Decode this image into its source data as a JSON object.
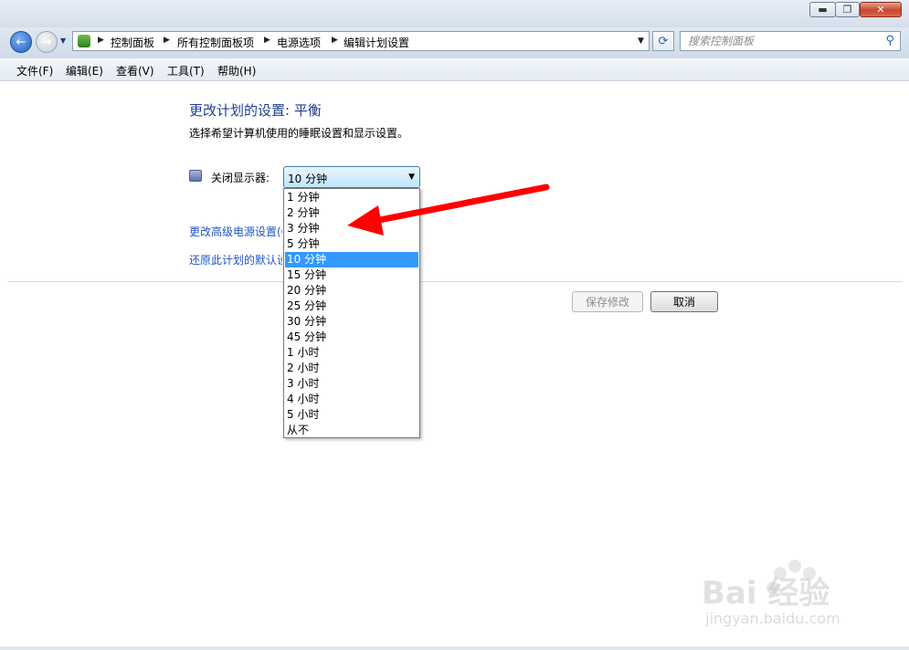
{
  "window": {
    "minimize_label": "▬",
    "maximize_label": "❐",
    "close_label": "✕"
  },
  "nav": {
    "back_glyph": "←",
    "forward_glyph": "→",
    "breadcrumb": [
      "控制面板",
      "所有控制面板项",
      "电源选项",
      "编辑计划设置"
    ],
    "refresh_glyph": "⟳"
  },
  "search": {
    "placeholder": "搜索控制面板"
  },
  "menu": [
    "文件(F)",
    "编辑(E)",
    "查看(V)",
    "工具(T)",
    "帮助(H)"
  ],
  "content": {
    "title": "更改计划的设置: 平衡",
    "subtitle": "选择希望计算机使用的睡眠设置和显示设置。",
    "display_label": "关闭显示器:",
    "display_value": "10 分钟",
    "advanced_link": "更改高级电源设置(C)",
    "restore_link": "还原此计划的默认设置",
    "save_button": "保存修改",
    "cancel_button": "取消"
  },
  "dropdown": {
    "options": [
      "1 分钟",
      "2 分钟",
      "3 分钟",
      "5 分钟",
      "10 分钟",
      "15 分钟",
      "20 分钟",
      "25 分钟",
      "30 分钟",
      "45 分钟",
      "1 小时",
      "2 小时",
      "3 小时",
      "4 小时",
      "5 小时",
      "从不"
    ],
    "selected_index": 4,
    "selected_color": "#3399ff"
  },
  "annotation": {
    "arrow_color": "#ff0000"
  },
  "watermark": {
    "text": "Bai 经验",
    "sub": "jingyan.baidu.com"
  }
}
